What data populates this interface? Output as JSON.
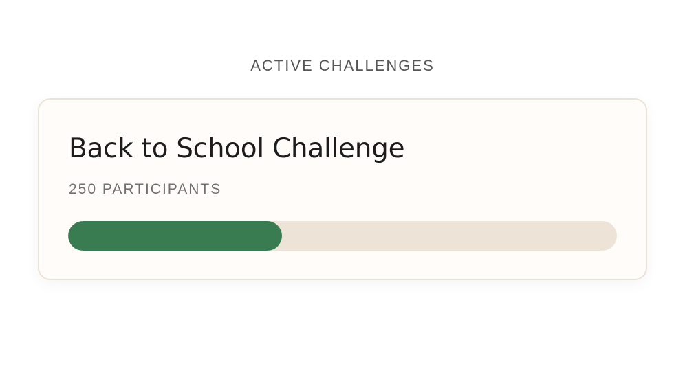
{
  "section": {
    "heading": "ACTIVE CHALLENGES"
  },
  "challenge": {
    "title": "Back to School Challenge",
    "participants_label": "250 PARTICIPANTS",
    "progress_fraction": 0.39
  },
  "colors": {
    "progress_fill": "#3a7c52",
    "progress_track": "#ede3d7",
    "card_background": "#fffcf9",
    "card_border": "#ece3d7"
  }
}
